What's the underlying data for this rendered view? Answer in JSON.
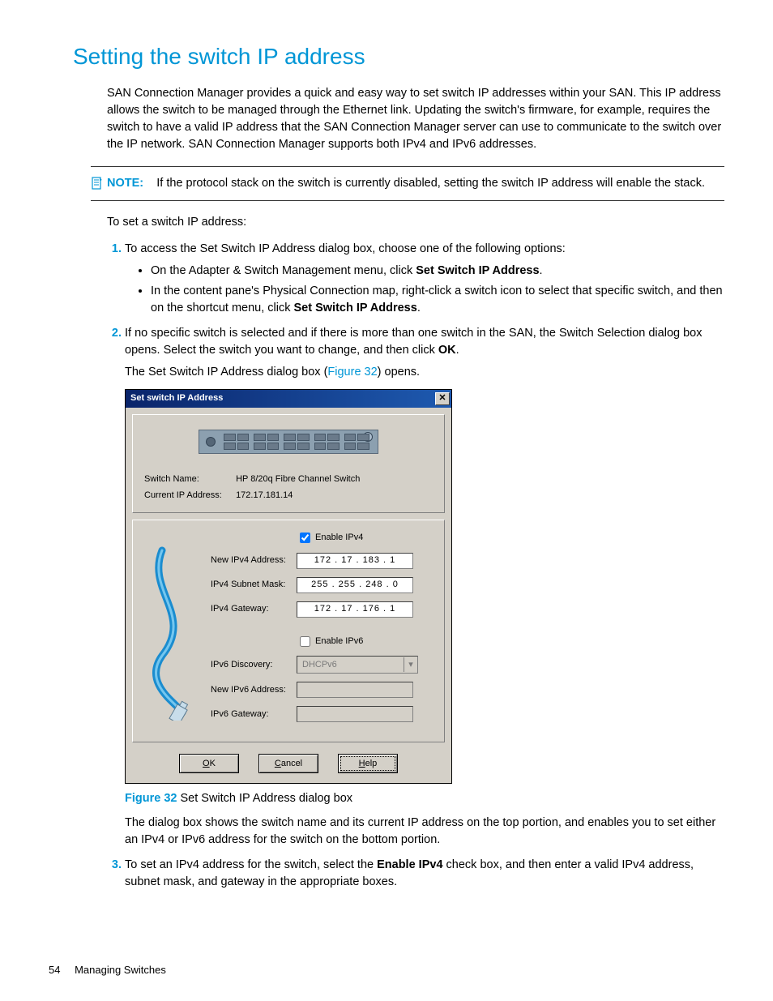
{
  "heading": "Setting the switch IP address",
  "intro": "SAN Connection Manager provides a quick and easy way to set switch IP addresses within your SAN. This IP address allows the switch to be managed through the Ethernet link. Updating the switch's firmware, for example, requires the switch to have a valid IP address that the SAN Connection Manager server can use to communicate to the switch over the IP network. SAN Connection Manager supports both IPv4 and IPv6 addresses.",
  "note": {
    "label": "NOTE:",
    "text": "If the protocol stack on the switch is currently disabled, setting the switch IP address will enable the stack."
  },
  "lead": "To set a switch IP address:",
  "step1": {
    "text": "To access the Set Switch IP Address dialog box, choose one of the following options:",
    "bullets": [
      {
        "pre": "On the Adapter & Switch Management menu, click ",
        "bold": "Set Switch IP Address",
        "post": "."
      },
      {
        "pre": "In the content pane's Physical Connection map, right-click a switch icon to select that specific switch, and then on the shortcut menu, click ",
        "bold": "Set Switch IP Address",
        "post": "."
      }
    ]
  },
  "step2": {
    "text_pre": "If no specific switch is selected and if there is more than one switch in the SAN, the Switch Selection dialog box opens. Select the switch you want to change, and then click ",
    "text_bold": "OK",
    "text_post": ".",
    "sub_pre": "The Set Switch IP Address dialog box (",
    "sub_link": "Figure 32",
    "sub_post": ") opens."
  },
  "dialog": {
    "title": "Set switch IP Address",
    "close_glyph": "✕",
    "switch_name_label": "Switch Name:",
    "switch_name_value": "HP 8/20q Fibre Channel Switch",
    "current_ip_label": "Current IP Address:",
    "current_ip_value": "172.17.181.14",
    "enable_ipv4_label": "Enable IPv4",
    "rows_v4": {
      "addr_label": "New IPv4 Address:",
      "addr_value": "172   .  17   .  183  .    1",
      "mask_label": "IPv4 Subnet Mask:",
      "mask_value": "255  . 255  .  248  .    0",
      "gw_label": "IPv4 Gateway:",
      "gw_value": "172   .  17   .  176  .    1"
    },
    "enable_ipv6_label": "Enable IPv6",
    "rows_v6": {
      "disc_label": "IPv6 Discovery:",
      "disc_value": "DHCPv6",
      "addr_label": "New IPv6 Address:",
      "gw_label": "IPv6 Gateway:"
    },
    "buttons": {
      "ok": "OK",
      "cancel": "Cancel",
      "help": "Help"
    },
    "underline": {
      "ok": "O",
      "cancel": "C",
      "help": "H"
    }
  },
  "figure": {
    "label": "Figure 32",
    "caption": " Set Switch IP Address dialog box"
  },
  "after_fig": "The dialog box shows the switch name and its current IP address on the top portion, and enables you to set either an IPv4 or IPv6 address for the switch on the bottom portion.",
  "step3": {
    "pre": "To set an IPv4 address for the switch, select the ",
    "bold": "Enable IPv4",
    "post": " check box, and then enter a valid IPv4 address, subnet mask, and gateway in the appropriate boxes."
  },
  "footer": {
    "page": "54",
    "section": "Managing Switches"
  }
}
